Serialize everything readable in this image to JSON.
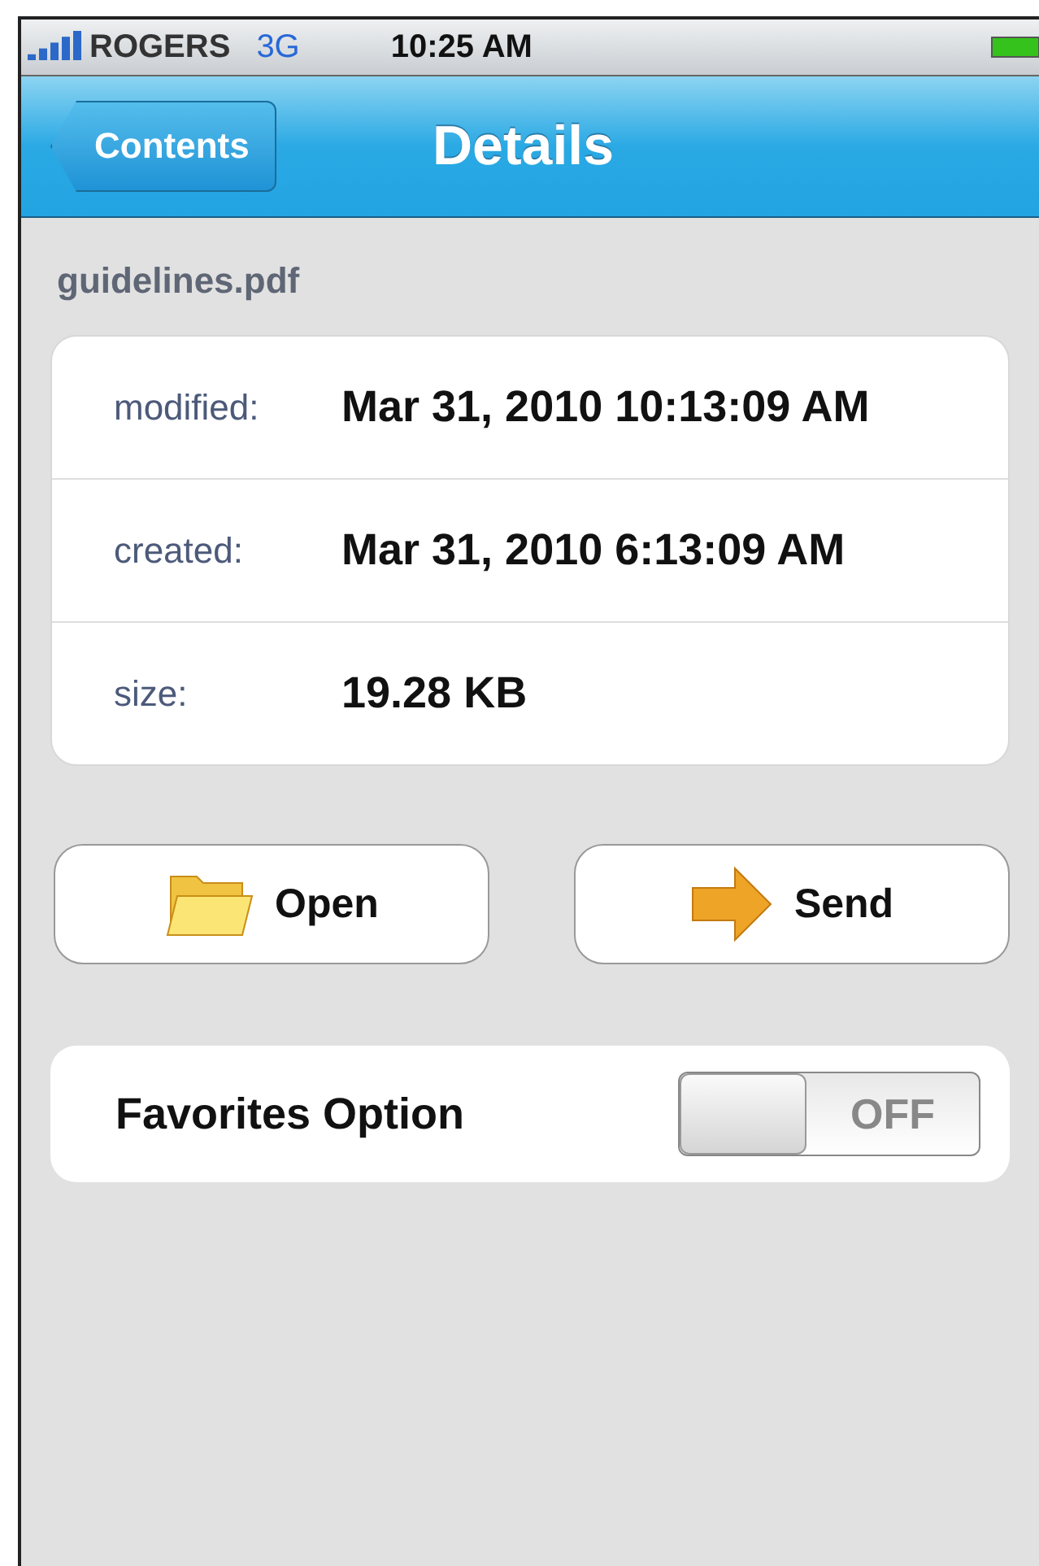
{
  "status_bar": {
    "carrier": "ROGERS",
    "network": "3G",
    "time": "10:25 AM"
  },
  "nav_bar": {
    "back": "Contents",
    "title": "Details"
  },
  "file_name": "guidelines.pdf",
  "details": [
    {
      "label": "modified:",
      "value": "Mar 31, 2010 10:13:09 AM"
    },
    {
      "label": "created:",
      "value": "Mar 31, 2010 6:13:09 AM"
    },
    {
      "label": "size:",
      "value": "19.28 KB"
    }
  ],
  "buttons": [
    {
      "kind": "folder",
      "label": "Open"
    },
    {
      "kind": "arrow",
      "label": "Send"
    }
  ],
  "favorites": {
    "label": "Favorites Option",
    "on": false,
    "switch_text": "OFF"
  }
}
